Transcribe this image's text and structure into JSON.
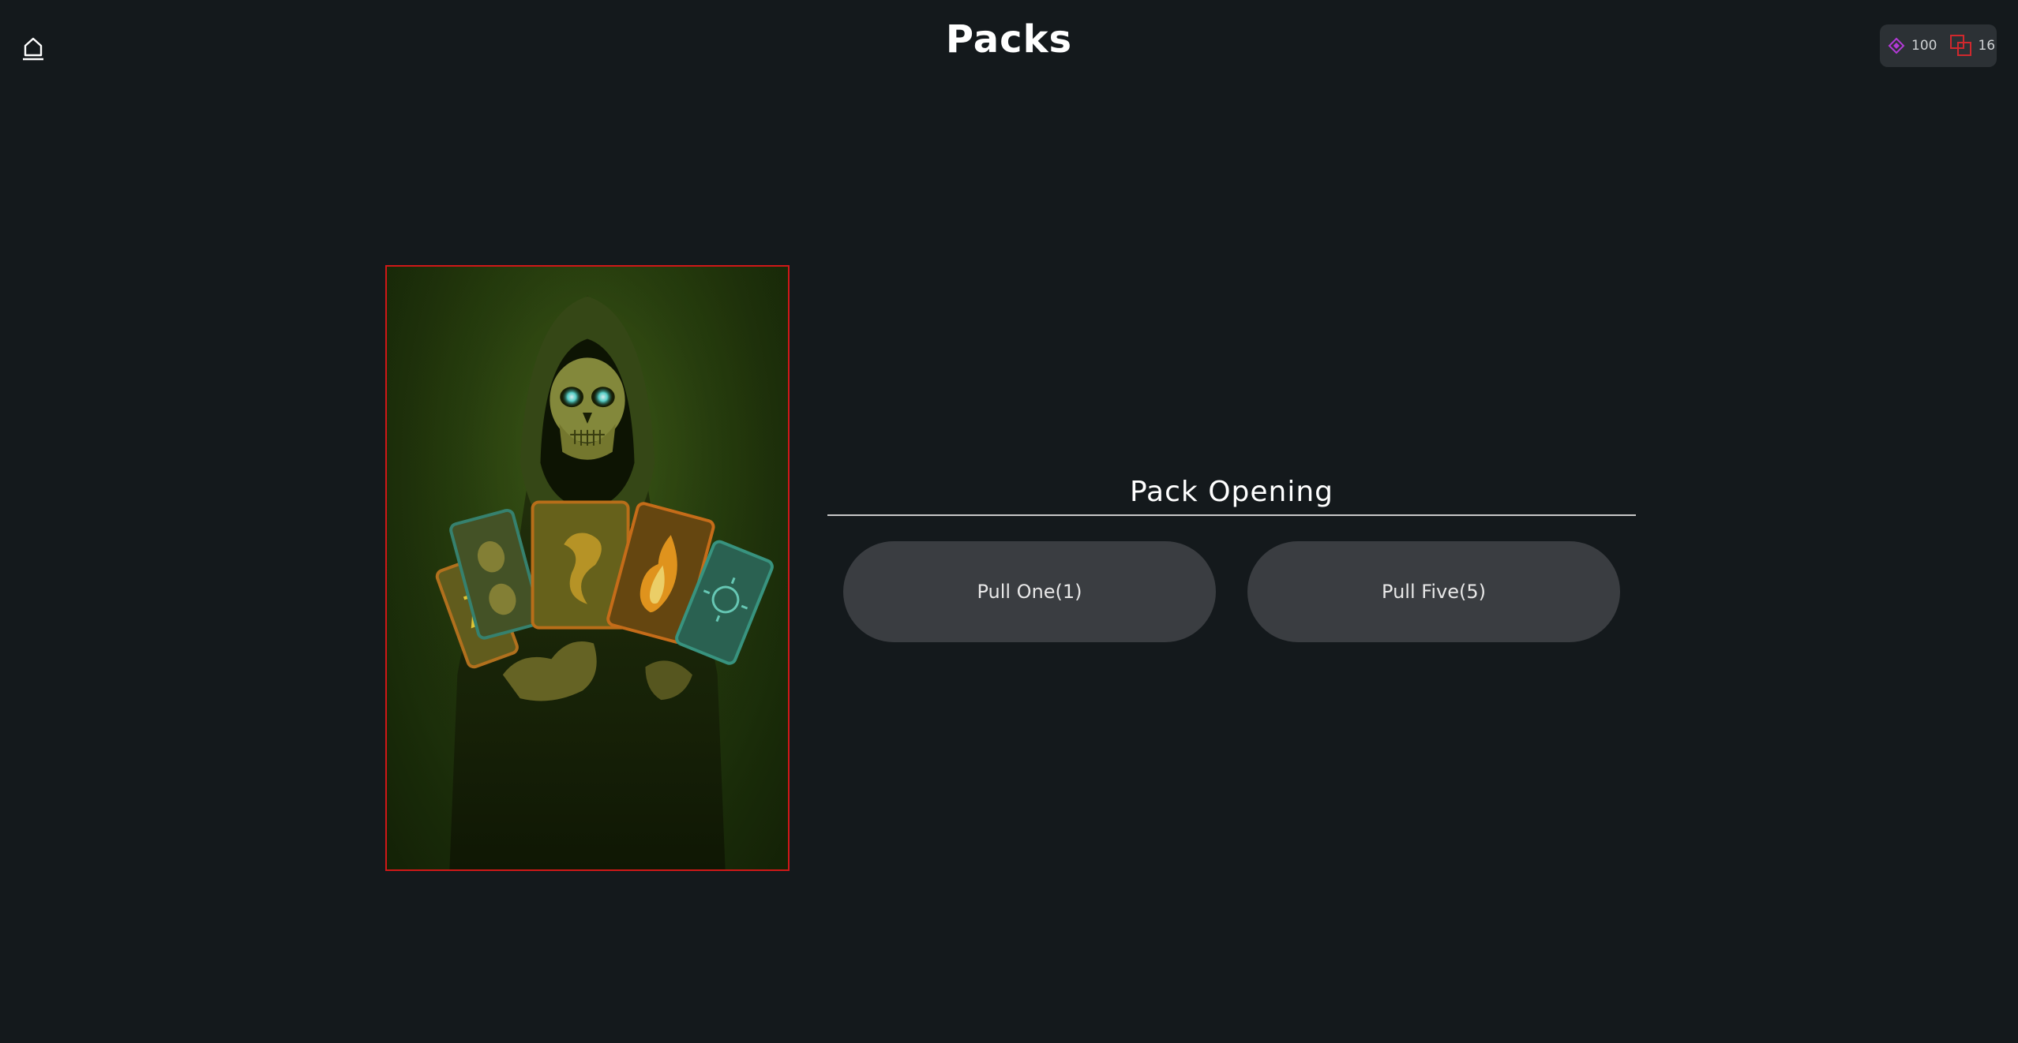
{
  "header": {
    "title": "Packs",
    "home_icon": "home-icon"
  },
  "currency": {
    "gems": {
      "icon": "gem-icon",
      "value": "100",
      "color": "#b23ad6"
    },
    "cards": {
      "icon": "cards-icon",
      "value": "16",
      "color": "#d0282d"
    }
  },
  "pack": {
    "border_color": "#d01818"
  },
  "pack_opening": {
    "title": "Pack Opening",
    "pull_one_label": "Pull One(1)",
    "pull_five_label": "Pull Five(5)"
  }
}
